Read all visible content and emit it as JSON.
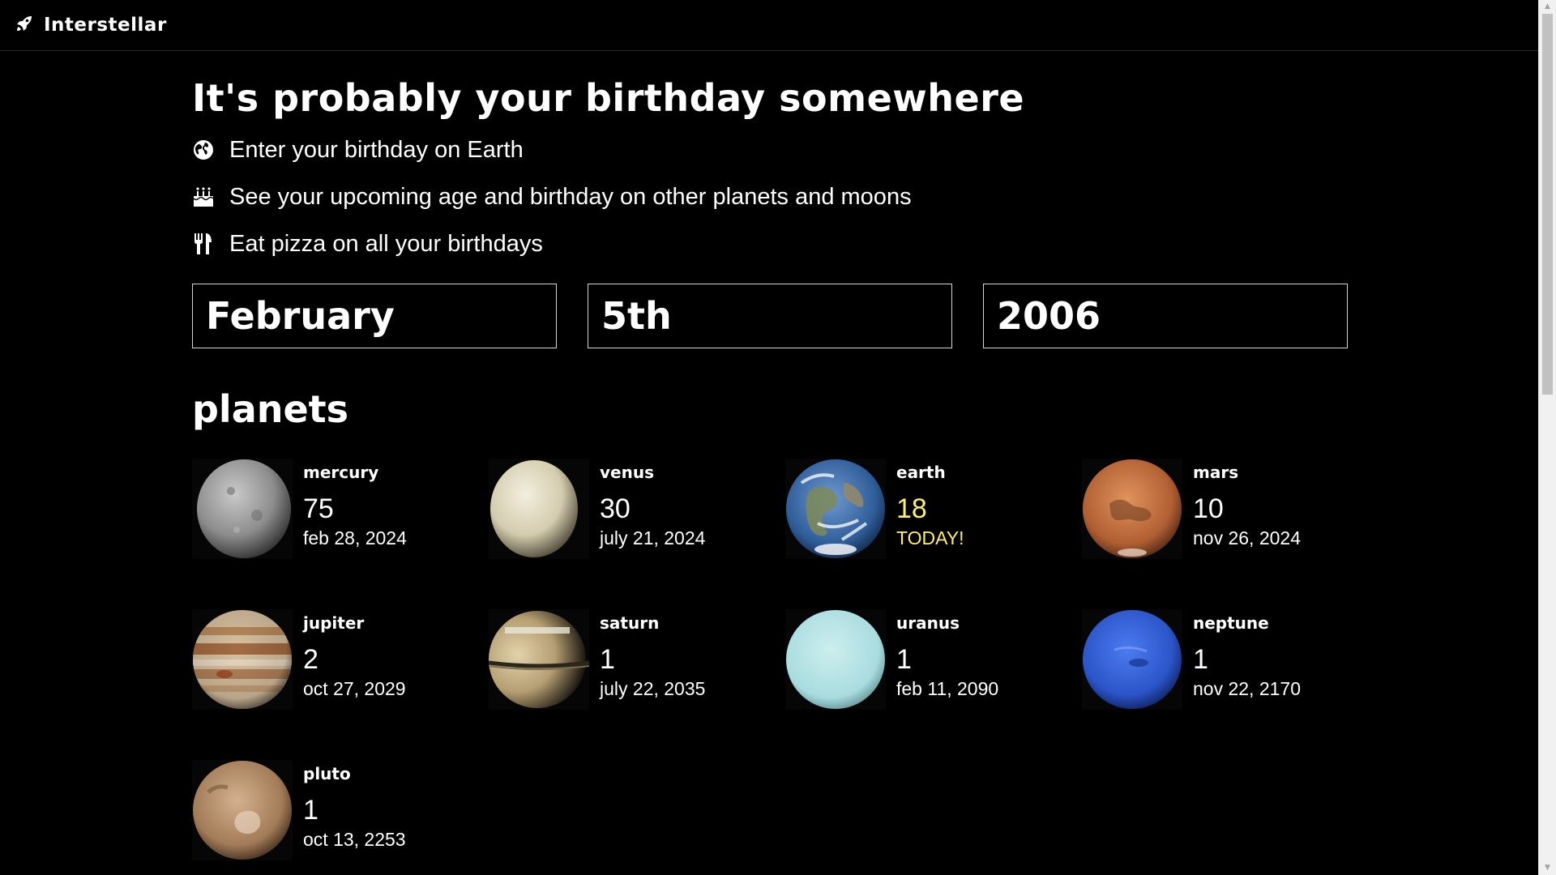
{
  "nav": {
    "brand": "Interstellar",
    "icon": "rocket-icon"
  },
  "hero": {
    "headline": "It's probably your birthday somewhere",
    "steps": [
      {
        "icon": "globe-icon",
        "text": "Enter your birthday on Earth"
      },
      {
        "icon": "birthday-cake-icon",
        "text": "See your upcoming age and birthday on other planets and moons"
      },
      {
        "icon": "utensils-icon",
        "text": "Eat pizza on all your birthdays"
      }
    ]
  },
  "form": {
    "month": "February",
    "day": "5th",
    "year": "2006"
  },
  "planets_section": {
    "title": "planets",
    "items": [
      {
        "name": "mercury",
        "age": "75",
        "date": "feb 28, 2024",
        "color": "#9a9a9a"
      },
      {
        "name": "venus",
        "age": "30",
        "date": "july 21, 2024",
        "color": "#e3dcc5"
      },
      {
        "name": "earth",
        "age": "18",
        "date": "TODAY!",
        "today": true,
        "color": "#3a6aa8"
      },
      {
        "name": "mars",
        "age": "10",
        "date": "nov 26, 2024",
        "color": "#c1673a"
      },
      {
        "name": "jupiter",
        "age": "2",
        "date": "oct 27, 2029",
        "color": "#c9a27b"
      },
      {
        "name": "saturn",
        "age": "1",
        "date": "july 22, 2035",
        "color": "#c8b690"
      },
      {
        "name": "uranus",
        "age": "1",
        "date": "feb 11, 2090",
        "color": "#b7e3e4"
      },
      {
        "name": "neptune",
        "age": "1",
        "date": "nov 22, 2170",
        "color": "#2f5fd6"
      },
      {
        "name": "pluto",
        "age": "1",
        "date": "oct 13, 2253",
        "color": "#b08a68"
      }
    ]
  },
  "colors": {
    "background": "#000000",
    "text": "#ffffff",
    "today": "#fff06a"
  }
}
